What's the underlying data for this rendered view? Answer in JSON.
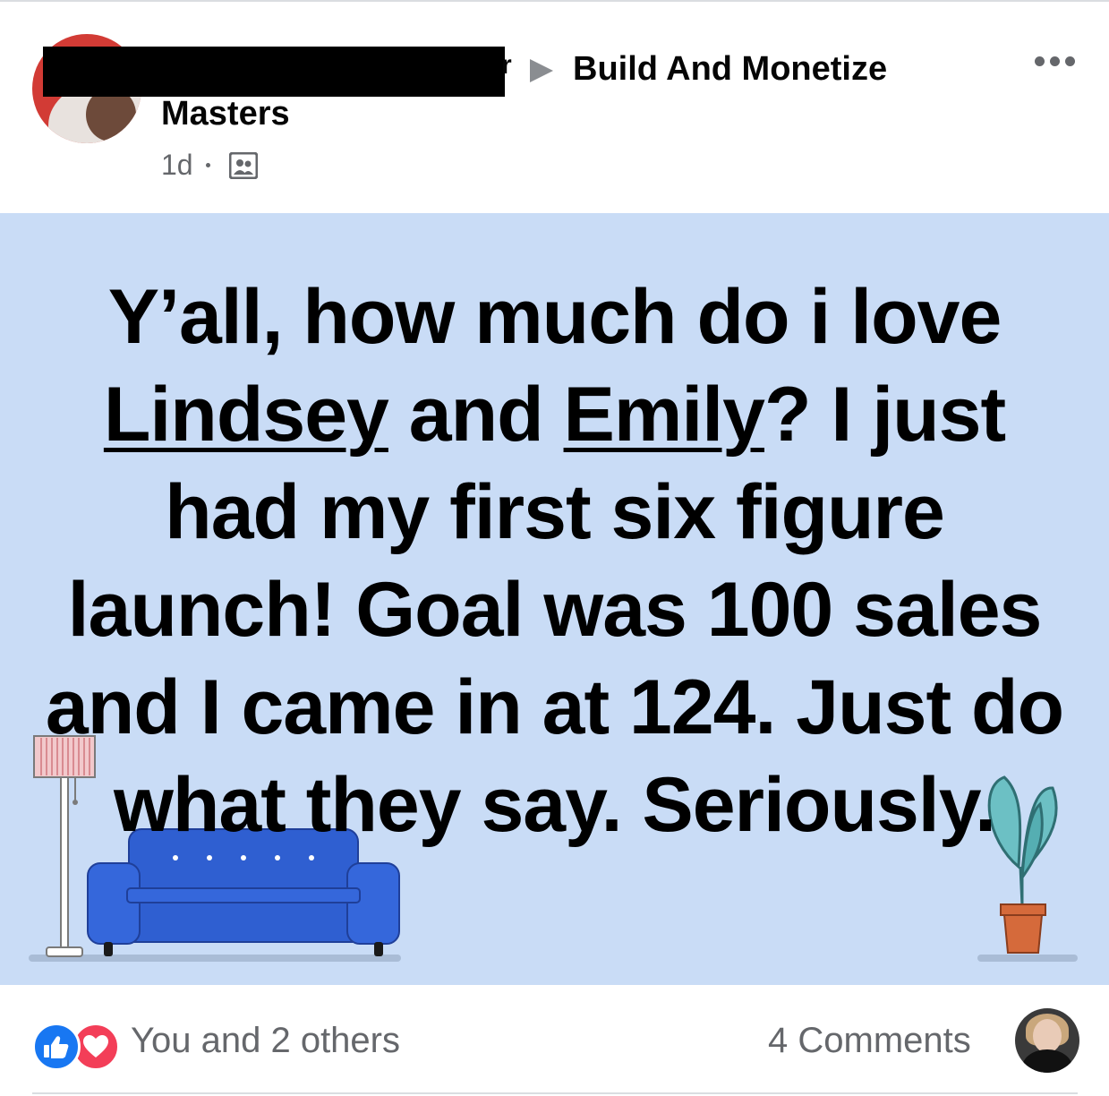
{
  "header": {
    "author_suffix": "r",
    "group_name_line1": "Build And Monetize",
    "group_name_line2": "Masters",
    "timestamp": "1d",
    "privacy_icon": "group-members-icon",
    "more_icon": "more-dots-icon"
  },
  "post": {
    "background_color": "#c9dcf6",
    "text_before": "Y’all, how much do i love ",
    "mention_1": "Lindsey",
    "text_between": " and ",
    "mention_2": "Emily",
    "text_after": "? I just had my first six figure launch! Goal was 100 sales and I came in at 124. Just do what they say. Seriously."
  },
  "footer": {
    "reaction_icons": [
      "like-icon",
      "love-icon"
    ],
    "reactions_text": "You and 2 others",
    "comments_text": "4 Comments"
  }
}
